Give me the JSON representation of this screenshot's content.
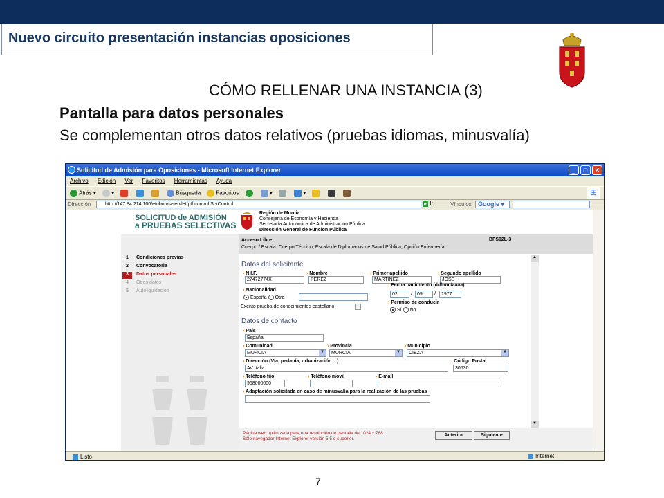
{
  "slide": {
    "header_title": "Nuevo circuito presentación instancias oposiciones",
    "heading": "CÓMO RELLENAR UNA INSTANCIA (3)",
    "subheading": "Pantalla para datos personales",
    "description": "Se complementan otros datos relativos (pruebas idiomas, minusvalía)",
    "page_number": "7"
  },
  "browser": {
    "window_title": "Solicitud de Admisión para Oposiciones - Microsoft Internet Explorer",
    "menu": [
      "Archivo",
      "Edición",
      "Ver",
      "Favoritos",
      "Herramientas",
      "Ayuda"
    ],
    "toolbar": {
      "back": "Atrás",
      "search": "Búsqueda",
      "favorites": "Favoritos"
    },
    "address_label": "Dirección",
    "address_url": "http://147.84.214.100/etributos/servlet/ptf.control.SrvControl",
    "go_label": "Ir",
    "links_label": "Vínculos",
    "google_label": "Google",
    "status_text": "Listo",
    "zone_text": "Internet"
  },
  "page": {
    "logo_line1": "SOLICITUD de ADMISIÓN",
    "logo_line2": "a PRUEBAS SELECTIVAS",
    "region": [
      "Región de Murcia",
      "Consejería de Economía y Hacienda",
      "Secretaría Autonómica de Administración Pública",
      "Dirección General de Función Pública"
    ],
    "access_type": "Acceso Libre",
    "form_code": "BFS02L-3",
    "body_scale": "Cuerpo / Escala: Cuerpo Técnico, Escala de Diplomados de Salud Pública, Opción Enfermería",
    "steps": [
      {
        "num": "1",
        "label": "Condiciones previas"
      },
      {
        "num": "2",
        "label": "Convocatoria"
      },
      {
        "num": "3",
        "label": "Datos personales"
      },
      {
        "num": "4",
        "label": "Otros datos"
      },
      {
        "num": "5",
        "label": "Autoliquidación"
      }
    ],
    "applicant_section": "Datos del solicitante",
    "contact_section": "Datos de contacto",
    "fields": {
      "nif_label": "N.I.F.",
      "nif_value": "27472774X",
      "nombre_label": "Nombre",
      "nombre_value": "PEREZ",
      "apellido1_label": "Primer apellido",
      "apellido1_value": "MARTINEZ",
      "apellido2_label": "Segundo apellido",
      "apellido2_value": "JOSE",
      "nacionalidad_label": "Nacionalidad",
      "espana": "España",
      "otra": "Otra",
      "fecha_label": "Fecha nacimiento (dd/mm/aaaa)",
      "dia": "02",
      "mes": "09",
      "anio": "1977",
      "exento_label": "Exento prueba de conocimientos castellano",
      "permiso_label": "Permiso de conducir",
      "si": "Sí",
      "no": "No",
      "pais_label": "País",
      "pais_value": "España",
      "comunidad_label": "Comunidad",
      "comunidad_value": "MURCIA",
      "provincia_label": "Provincia",
      "provincia_value": "MURCIA",
      "municipio_label": "Municipio",
      "municipio_value": "CIEZA",
      "direccion_label": "Dirección (Vía, pedanía, urbanización ...)",
      "direccion_value": "AV Italia",
      "cp_label": "Código Postal",
      "cp_value": "30530",
      "tfijo_label": "Teléfono fijo",
      "tfijo_value": "968000000",
      "tmovil_label": "Teléfono movil",
      "email_label": "E-mail",
      "adaptacion_label": "Adaptación solicitada en caso de minusvalía para la realización de las pruebas"
    },
    "note_line1": "Página web optimizada para una resolución de pantalla de 1024 x 768.",
    "note_line2": "Sólo navegador Internet Explorer versión 5.5 o superior.",
    "btn_prev": "Anterior",
    "btn_next": "Siguiente"
  },
  "colors": {
    "topbar": "#0d2e5c",
    "title_text": "#17375e",
    "accent_red": "#b32222"
  }
}
